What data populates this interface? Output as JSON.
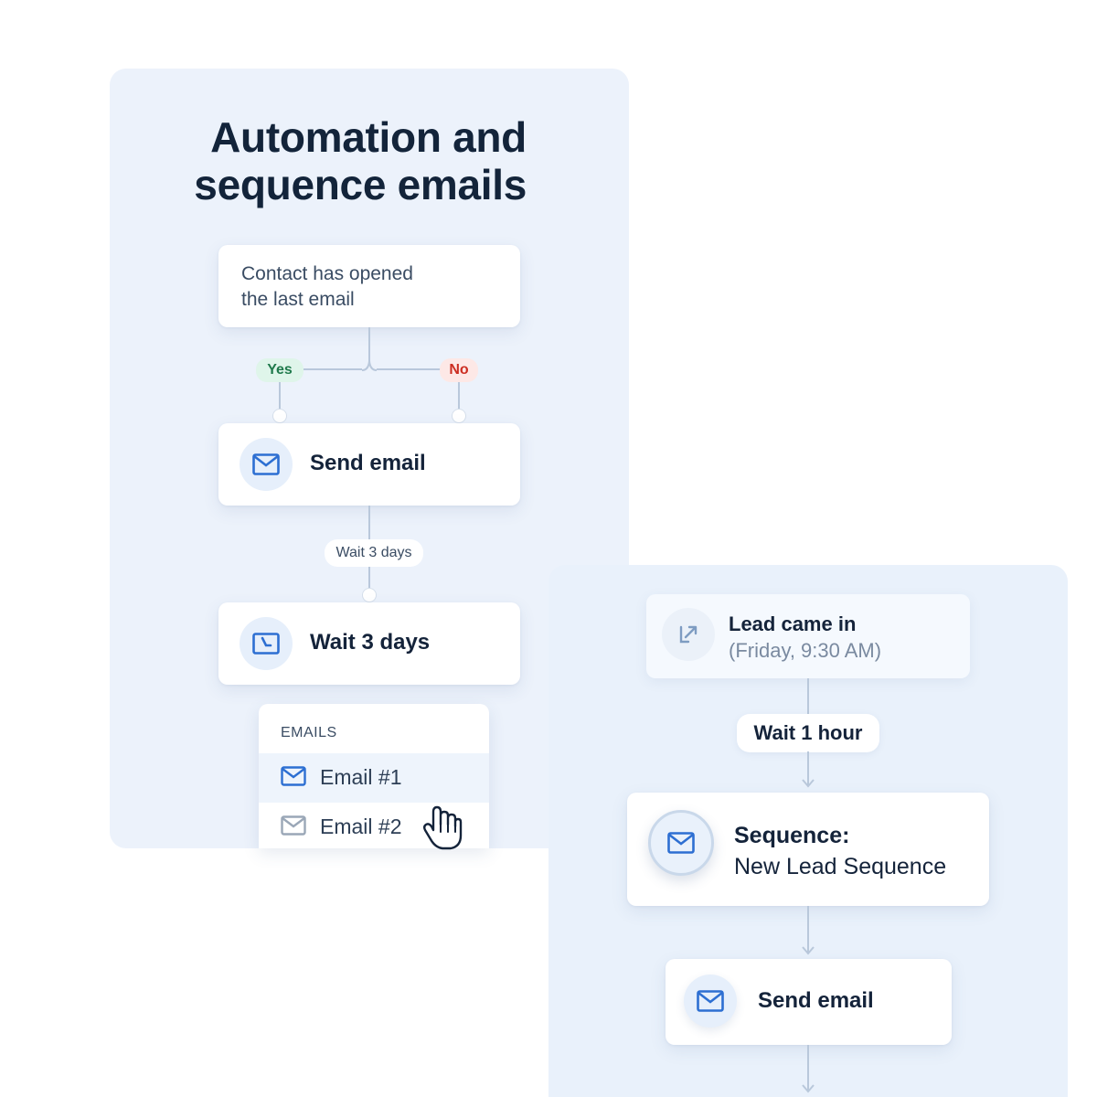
{
  "heading": {
    "line1": "Automation and",
    "line2": "sequence emails"
  },
  "left_flow": {
    "condition": {
      "line1": "Contact has opened",
      "line2": "the last email"
    },
    "branch_yes": "Yes",
    "branch_no": "No",
    "send_email": {
      "label": "Send email",
      "icon": "envelope-icon"
    },
    "wait_pill": "Wait 3 days",
    "wait_step": {
      "label": "Wait 3 days",
      "icon": "clock-icon"
    },
    "emails_dropdown": {
      "header": "EMAILS",
      "items": [
        {
          "label": "Email #1",
          "icon": "envelope-icon",
          "active": true
        },
        {
          "label": "Email #2",
          "icon": "envelope-icon",
          "active": false
        }
      ]
    }
  },
  "right_flow": {
    "trigger": {
      "title": "Lead came in",
      "subtitle": "(Friday, 9:30 AM)",
      "icon": "lead-arrow-icon"
    },
    "wait_pill": "Wait 1 hour",
    "sequence": {
      "title": "Sequence:",
      "name": "New Lead Sequence",
      "icon": "envelope-icon"
    },
    "send_email": {
      "label": "Send email",
      "icon": "envelope-icon"
    }
  },
  "colors": {
    "panel_bg": "#ecf2fb",
    "accent_blue": "#2d6fd2",
    "yes_green": "#207a4c",
    "no_red": "#cc2e22",
    "text_dark": "#14233a"
  }
}
